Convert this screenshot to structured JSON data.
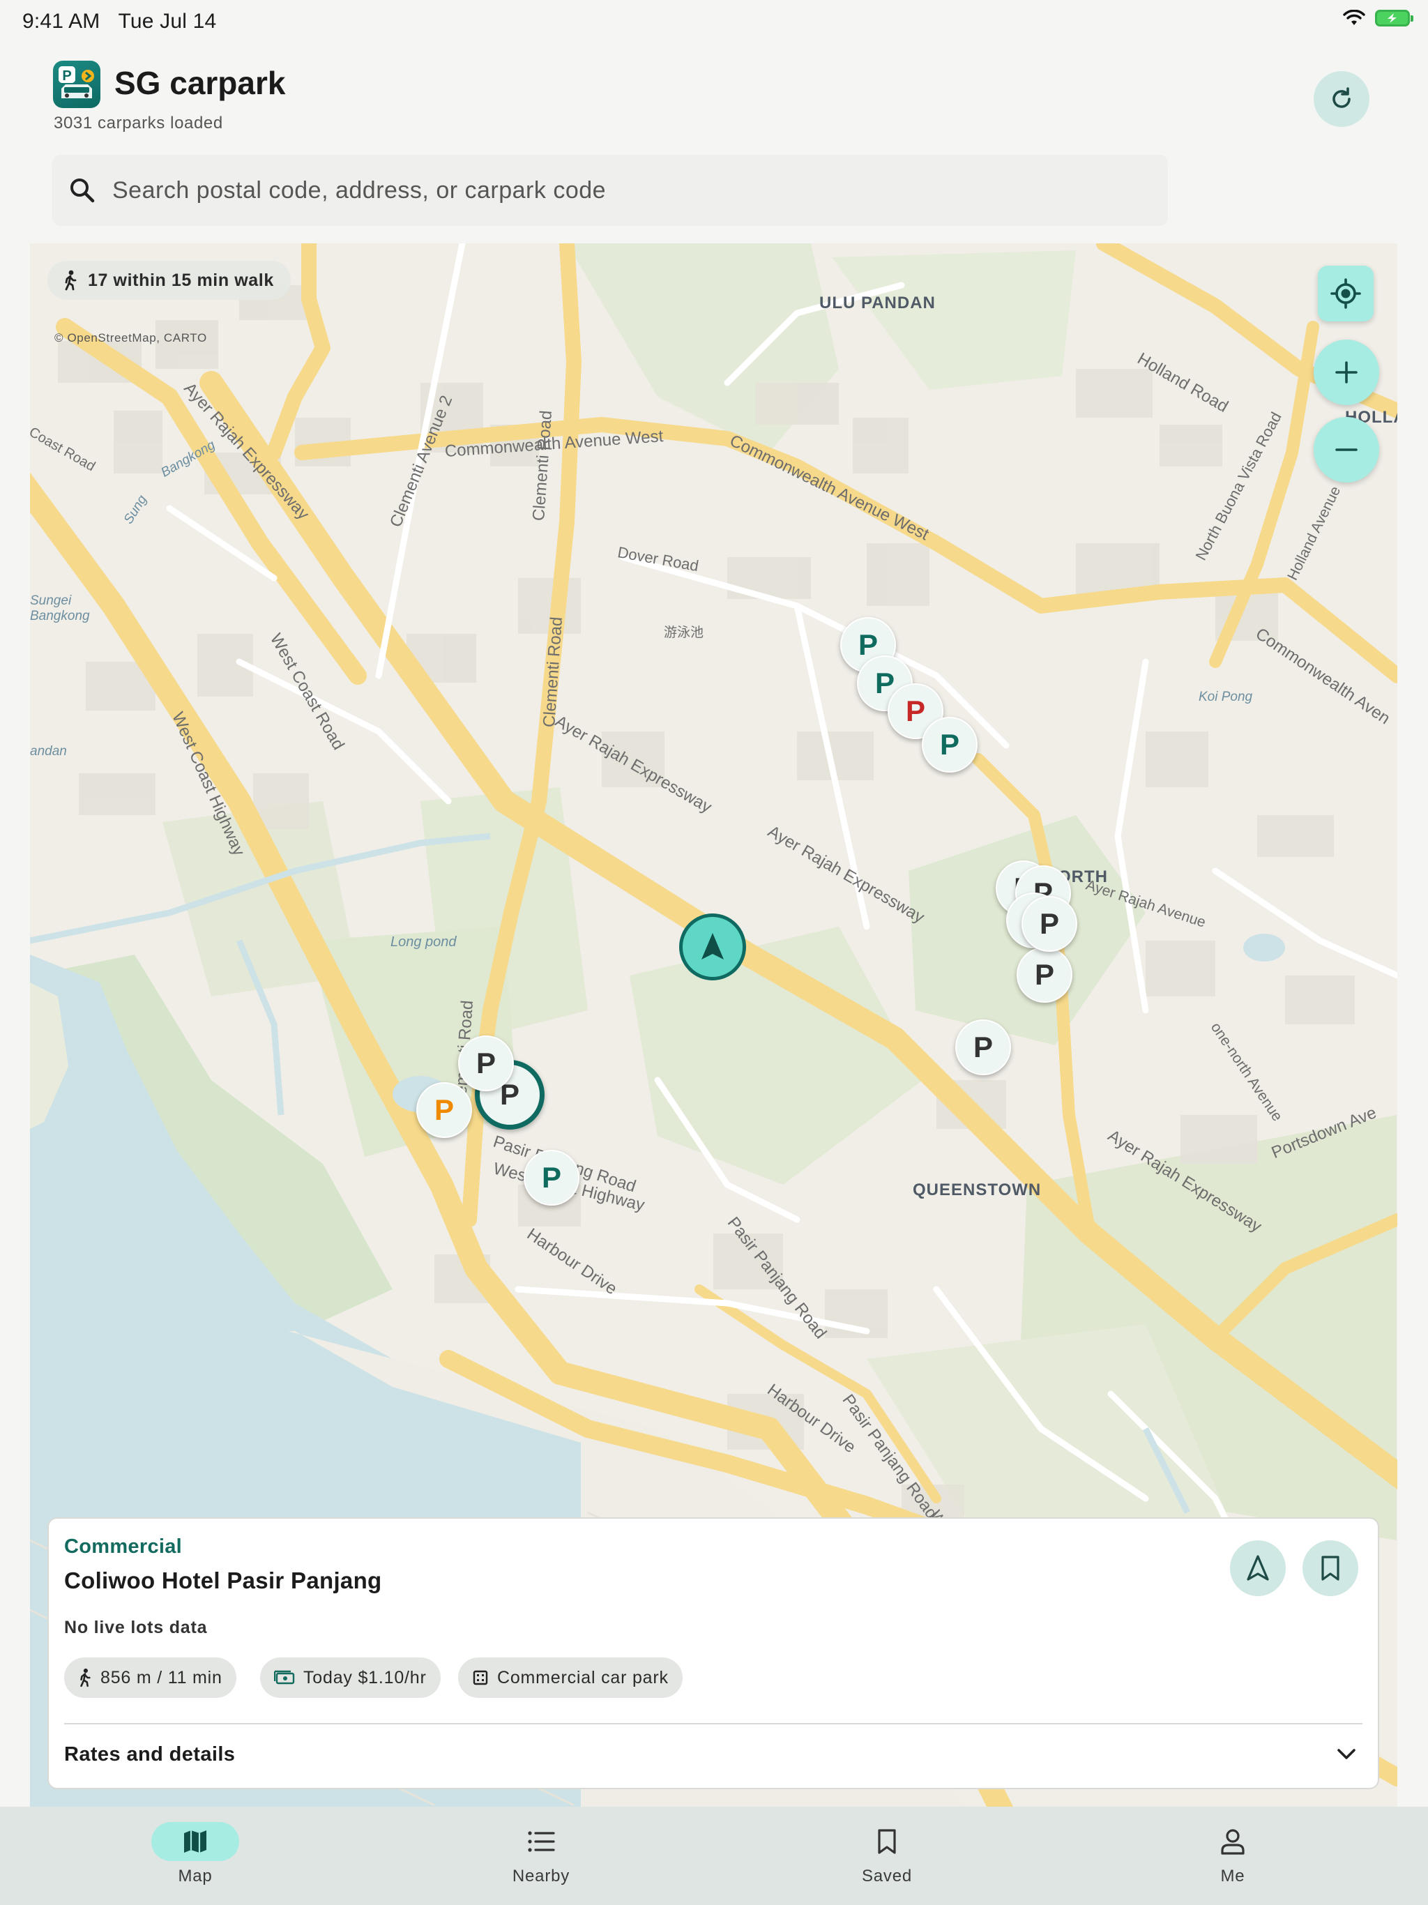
{
  "status_bar": {
    "time": "9:41 AM",
    "date": "Tue Jul 14",
    "wifi_icon": "wifi-icon",
    "battery_icon": "battery-charging-icon"
  },
  "header": {
    "title": "SG carpark",
    "subtitle": "3031 carparks loaded",
    "refresh_icon": "refresh-icon"
  },
  "search": {
    "placeholder": "Search postal code, address, or carpark code",
    "icon": "search-icon"
  },
  "map": {
    "walk_chip": "17 within 15 min walk",
    "attribution": "© OpenStreetMap, CARTO",
    "labels": {
      "ulu_pandan": "ULU PANDAN",
      "queenstown": "QUEENSTOWN",
      "north": "ORTH",
      "holla1": "HOLLA",
      "holla2": "LA",
      "commonwealth_ave_west": "Commonwealth Avenue West",
      "commonwealth_ave_west_2": "Commonwealth Avenue West",
      "commonwealth_ave": "Commonwealth Aven",
      "holland_road": "Holland Road",
      "north_buona_vista": "North Buona Vista Road",
      "holland_avenue": "Holland Avenue",
      "ayer_rajah_expressway_1": "Ayer Rajah Expressway",
      "ayer_rajah_expressway_2": "Ayer Rajah Expressway",
      "ayer_rajah_expressway_3": "Ayer Rajah Expressway",
      "ayer_rajah_expressway_4": "Ayer Rajah Expressway",
      "ayer_rajah_avenue": "Ayer Rajah Avenue",
      "one_north_avenue": "one-north Avenue",
      "portsdown_ave": "Portsdown Ave",
      "clementi_ave_2": "Clementi Avenue 2",
      "clementi_road_1": "Clementi Road",
      "clementi_road_2": "Clementi Road",
      "clementi_road_3": "Clementi Road",
      "dover_road": "Dover Road",
      "west_coast_road": "West Coast Road",
      "west_coast_highway": "West Coast Highway",
      "west_coast_highway_2": "West Coast Highway",
      "pasir_panjang_road_1": "Pasir Panjang Road",
      "pasir_panjang_road_2": "Pasir Panjang Road",
      "pasir_panjang_road_3": "Pasir Panjang Road",
      "harbour_drive_1": "Harbour Drive",
      "harbour_drive_2": "Harbour Drive",
      "long_pond": "Long pond",
      "sungei_bangkong": "Sungei Bangkong",
      "koi_pong": "Koi Pong",
      "coast_road": "Coast Road",
      "sung": "Sung",
      "bangkong": "Bangkong",
      "swimming_pool": "游泳池",
      "andan": "andan",
      "west": "West"
    },
    "marker_letter": "P",
    "markers": [
      {
        "status": "available",
        "color": "#106b5f"
      },
      {
        "status": "available",
        "color": "#106b5f"
      },
      {
        "status": "full",
        "color": "#c62828"
      },
      {
        "status": "available",
        "color": "#106b5f"
      },
      {
        "status": "no-data",
        "color": "#333333"
      },
      {
        "status": "no-data",
        "color": "#333333"
      },
      {
        "status": "no-data",
        "color": "#333333"
      },
      {
        "status": "no-data",
        "color": "#333333"
      },
      {
        "status": "no-data",
        "color": "#333333"
      },
      {
        "status": "no-data",
        "color": "#333333"
      },
      {
        "status": "limited",
        "color": "#ef8a00"
      },
      {
        "status": "no-data",
        "color": "#333333"
      },
      {
        "status": "selected",
        "color": "#333333"
      },
      {
        "status": "available",
        "color": "#106b5f"
      }
    ],
    "controls": {
      "locate_icon": "crosshair-icon",
      "zoom_in_icon": "plus-icon",
      "zoom_out_icon": "minus-icon"
    }
  },
  "detail": {
    "category": "Commercial",
    "name": "Coliwoo Hotel Pasir Panjang",
    "lots_status": "No live lots data",
    "chips": [
      {
        "icon": "walk-icon",
        "label": "856 m / 11 min"
      },
      {
        "icon": "cash-icon",
        "label": "Today $1.10/hr"
      },
      {
        "icon": "building-icon",
        "label": "Commercial car park"
      }
    ],
    "rates_label": "Rates and details",
    "navigate_icon": "navigate-icon",
    "bookmark_icon": "bookmark-icon"
  },
  "bottom_nav": [
    {
      "label": "Map",
      "icon": "map-icon",
      "active": true
    },
    {
      "label": "Nearby",
      "icon": "list-icon",
      "active": false
    },
    {
      "label": "Saved",
      "icon": "bookmark-icon",
      "active": false
    },
    {
      "label": "Me",
      "icon": "person-icon",
      "active": false
    }
  ],
  "colors": {
    "accent": "#0f6b61",
    "accent_light": "#a6ece2",
    "available": "#106b5f",
    "full": "#c62828",
    "limited": "#ef8a00"
  }
}
